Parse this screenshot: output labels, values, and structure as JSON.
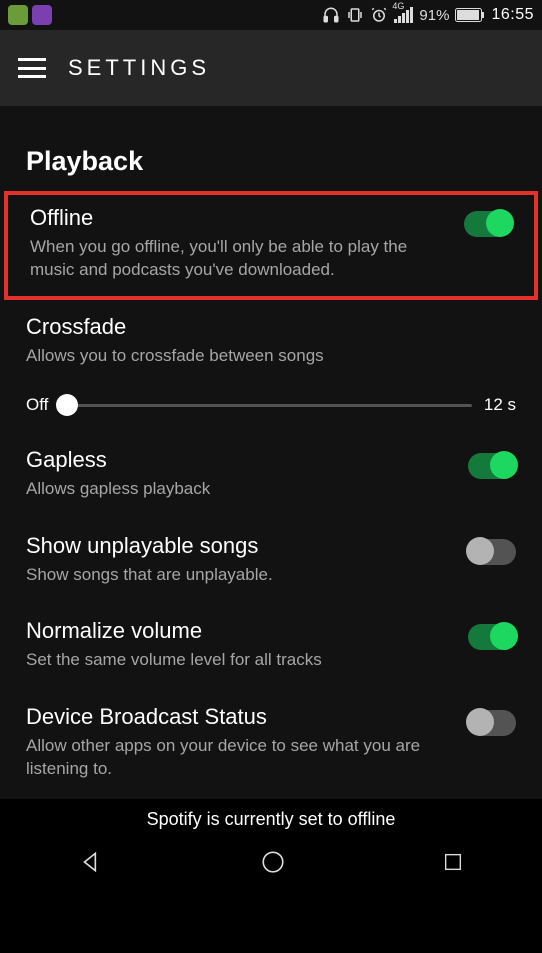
{
  "status_bar": {
    "battery_pct": "91%",
    "clock": "16:55",
    "network_label": "4G"
  },
  "header": {
    "title": "SETTINGS"
  },
  "section": {
    "title": "Playback"
  },
  "settings": {
    "offline": {
      "title": "Offline",
      "desc": "When you go offline, you'll only be able to play the music and podcasts you've downloaded.",
      "on": true
    },
    "crossfade": {
      "title": "Crossfade",
      "desc": "Allows you to crossfade between songs",
      "slider_left": "Off",
      "slider_right": "12 s"
    },
    "gapless": {
      "title": "Gapless",
      "desc": "Allows gapless playback",
      "on": true
    },
    "unplayable": {
      "title": "Show unplayable songs",
      "desc": "Show songs that are unplayable.",
      "on": false
    },
    "normalize": {
      "title": "Normalize volume",
      "desc": "Set the same volume level for all tracks",
      "on": true
    },
    "broadcast": {
      "title": "Device Broadcast Status",
      "desc": "Allow other apps on your device to see what you are listening to.",
      "on": false
    }
  },
  "caption": "Spotify is currently set to offline"
}
